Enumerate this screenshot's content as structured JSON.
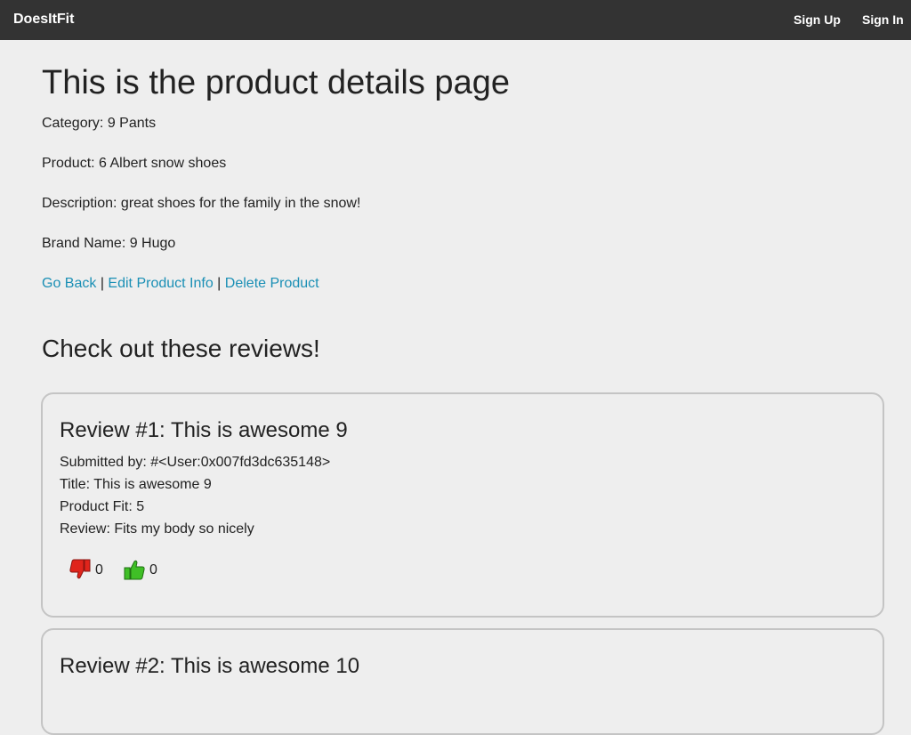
{
  "nav": {
    "brand": "DoesItFit",
    "signup": "Sign Up",
    "signin": "Sign In"
  },
  "page": {
    "title": "This is the product details page",
    "category": "Category: 9 Pants",
    "product": "Product: 6 Albert snow shoes",
    "description": "Description: great shoes for the family in the snow!",
    "brand_name": "Brand Name: 9 Hugo"
  },
  "links": {
    "go_back": "Go Back",
    "edit": "Edit Product Info",
    "delete": "Delete Product",
    "separator": "|"
  },
  "reviews_heading": "Check out these reviews!",
  "reviews": [
    {
      "heading": "Review #1: This is awesome 9",
      "submitted_by": "Submitted by: #<User:0x007fd3dc635148>",
      "title": "Title: This is awesome 9",
      "fit": "Product Fit: 5",
      "review": "Review: Fits my body so nicely",
      "thumbs_down": "0",
      "thumbs_up": "0"
    },
    {
      "heading": "Review #2: This is awesome 10"
    }
  ],
  "icons": {
    "thumbs_down": "thumbs-down-icon",
    "thumbs_up": "thumbs-up-icon"
  },
  "colors": {
    "navbar": "#333333",
    "link": "#1a8fb5",
    "thumbs_down": "#e0241b",
    "thumbs_up": "#3fbf26"
  }
}
